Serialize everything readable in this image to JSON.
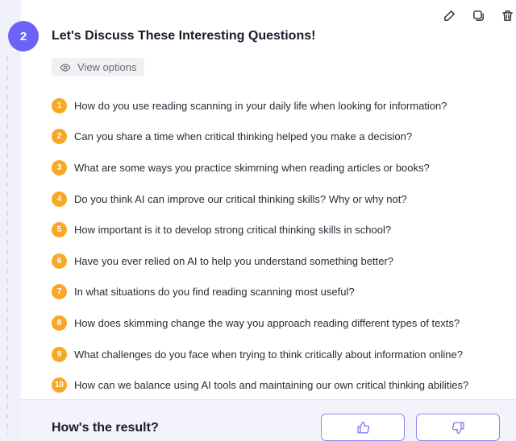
{
  "step": {
    "number": "2"
  },
  "title": "Let's Discuss These Interesting Questions!",
  "view_options": {
    "label": "View options",
    "icon": "eye-icon"
  },
  "toolbar": {
    "icons": [
      "pencil-icon",
      "copy-icon",
      "trash-icon"
    ]
  },
  "questions": [
    {
      "num": "1",
      "text": "How do you use reading scanning in your daily life when looking for information?"
    },
    {
      "num": "2",
      "text": "Can you share a time when critical thinking helped you make a decision?"
    },
    {
      "num": "3",
      "text": "What are some ways you practice skimming when reading articles or books?"
    },
    {
      "num": "4",
      "text": "Do you think AI can improve our critical thinking skills? Why or why not?"
    },
    {
      "num": "5",
      "text": "How important is it to develop strong critical thinking skills in school?"
    },
    {
      "num": "6",
      "text": "Have you ever relied on AI to help you understand something better?"
    },
    {
      "num": "7",
      "text": "In what situations do you find reading scanning most useful?"
    },
    {
      "num": "8",
      "text": "How does skimming change the way you approach reading different types of texts?"
    },
    {
      "num": "9",
      "text": "What challenges do you face when trying to think critically about information online?"
    },
    {
      "num": "10",
      "text": "How can we balance using AI tools and maintaining our own critical thinking abilities?"
    }
  ],
  "feedback": {
    "label": "How's the result?",
    "thumbs_up_icon": "thumbs-up-icon",
    "thumbs_down_icon": "thumbs-down-icon"
  },
  "colors": {
    "accent": "#6b63f6",
    "number_badge": "#f9a825",
    "result_bar": "#f3f3fc"
  }
}
